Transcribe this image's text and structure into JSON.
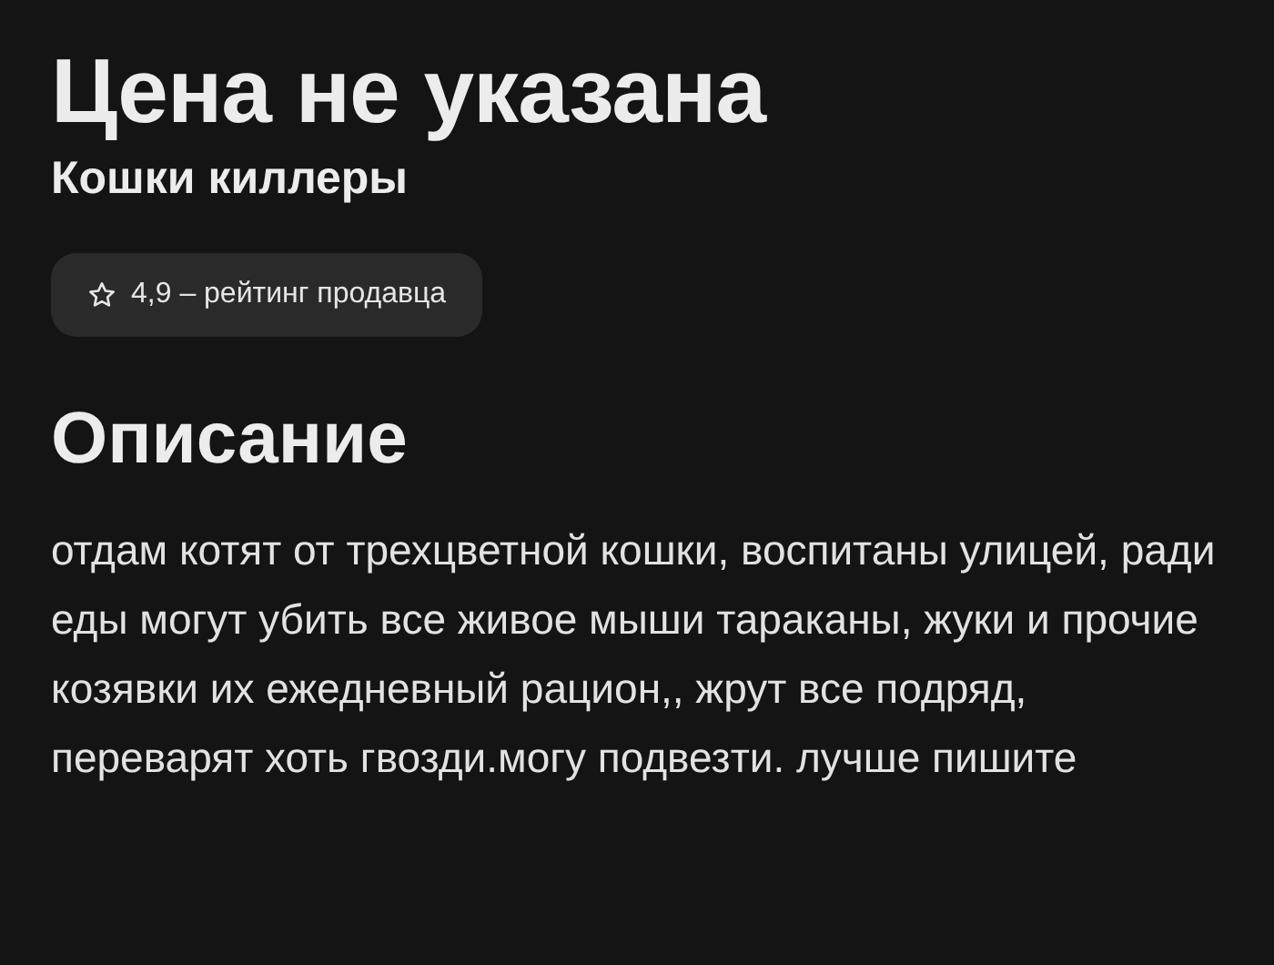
{
  "price": "Цена не указана",
  "seller": "Кошки киллеры",
  "rating": {
    "text": "4,9 – рейтинг продавца"
  },
  "description": {
    "heading": "Описание",
    "text": "отдам котят от трехцветной кошки, воспитаны улицей, ради еды могут убить все живое мыши тараканы, жуки и прочие козявки их ежедневный рацион,, жрут все подряд, переварят хоть гвозди.могу подвезти. лучше пишите"
  }
}
